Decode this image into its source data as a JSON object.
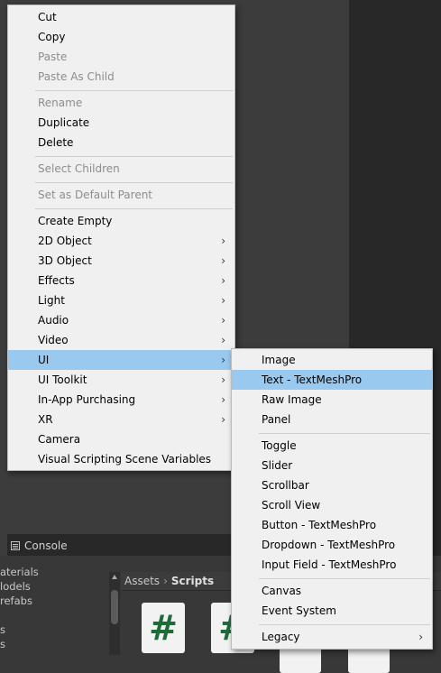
{
  "main_menu": {
    "items": [
      {
        "label": "Cut",
        "enabled": true
      },
      {
        "label": "Copy",
        "enabled": true
      },
      {
        "label": "Paste",
        "enabled": false
      },
      {
        "label": "Paste As Child",
        "enabled": false
      },
      {
        "label": "Rename",
        "enabled": false
      },
      {
        "label": "Duplicate",
        "enabled": true
      },
      {
        "label": "Delete",
        "enabled": true
      },
      {
        "label": "Select Children",
        "enabled": false
      },
      {
        "label": "Set as Default Parent",
        "enabled": false
      },
      {
        "label": "Create Empty",
        "enabled": true
      },
      {
        "label": "2D Object",
        "enabled": true,
        "submenu": true
      },
      {
        "label": "3D Object",
        "enabled": true,
        "submenu": true
      },
      {
        "label": "Effects",
        "enabled": true,
        "submenu": true
      },
      {
        "label": "Light",
        "enabled": true,
        "submenu": true
      },
      {
        "label": "Audio",
        "enabled": true,
        "submenu": true
      },
      {
        "label": "Video",
        "enabled": true,
        "submenu": true
      },
      {
        "label": "UI",
        "enabled": true,
        "submenu": true,
        "highlighted": true
      },
      {
        "label": "UI Toolkit",
        "enabled": true,
        "submenu": true
      },
      {
        "label": "In-App Purchasing",
        "enabled": true,
        "submenu": true
      },
      {
        "label": "XR",
        "enabled": true,
        "submenu": true
      },
      {
        "label": "Camera",
        "enabled": true
      },
      {
        "label": "Visual Scripting Scene Variables",
        "enabled": true
      }
    ]
  },
  "ui_submenu": {
    "items": [
      {
        "label": "Image"
      },
      {
        "label": "Text - TextMeshPro",
        "highlighted": true
      },
      {
        "label": "Raw Image"
      },
      {
        "label": "Panel"
      },
      {
        "label": "Toggle"
      },
      {
        "label": "Slider"
      },
      {
        "label": "Scrollbar"
      },
      {
        "label": "Scroll View"
      },
      {
        "label": "Button - TextMeshPro"
      },
      {
        "label": "Dropdown - TextMeshPro"
      },
      {
        "label": "Input Field - TextMeshPro"
      },
      {
        "label": "Canvas"
      },
      {
        "label": "Event System"
      },
      {
        "label": "Legacy",
        "submenu": true
      }
    ]
  },
  "bottom_panel": {
    "console_tab": "Console",
    "tree_items": [
      "aterials",
      "lodels",
      "refabs",
      "",
      "s",
      "s"
    ],
    "breadcrumb": {
      "root": "Assets",
      "separator": "›",
      "current": "Scripts"
    },
    "script_glyph": "#"
  },
  "colors": {
    "menu_bg": "#f0f0f0",
    "highlight": "#99c9ef",
    "disabled_text": "#8d8d8d",
    "script_icon": "#1e6b3a"
  }
}
